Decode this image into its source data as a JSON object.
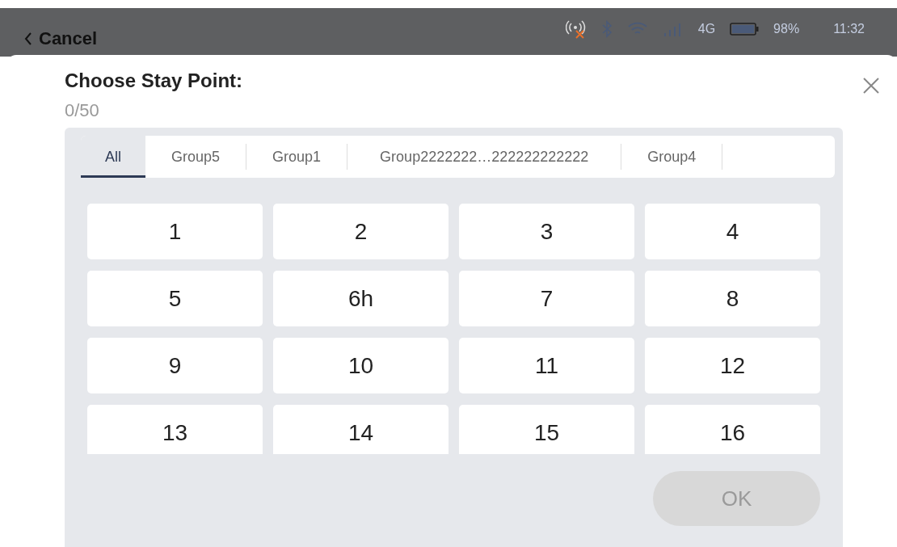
{
  "status_bar": {
    "network": "4G",
    "battery": "98%",
    "time": "11:32"
  },
  "nav": {
    "back": "Cancel"
  },
  "dialog": {
    "title": "Choose Stay Point:",
    "count": "0/50",
    "tabs": [
      {
        "label": "All",
        "selected": true
      },
      {
        "label": "Group5",
        "selected": false
      },
      {
        "label": "Group1",
        "selected": false
      },
      {
        "label": "Group2222222…222222222222",
        "selected": false
      },
      {
        "label": "Group4",
        "selected": false
      }
    ],
    "points": [
      "1",
      "2",
      "3",
      "4",
      "5",
      "6h",
      "7",
      "8",
      "9",
      "10",
      "11",
      "12",
      "13",
      "14",
      "15",
      "16"
    ],
    "ok_button": {
      "label": "OK",
      "disabled": true
    }
  }
}
